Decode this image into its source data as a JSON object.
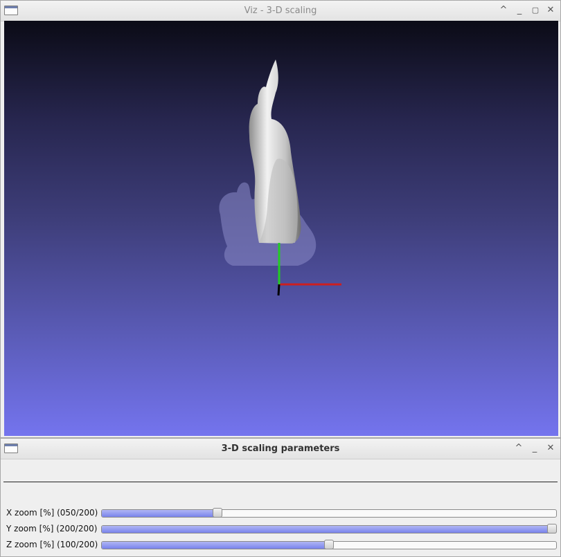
{
  "viz_window": {
    "title": "Viz - 3-D scaling",
    "icon": "window-menu-icon",
    "controls": [
      "shade-icon",
      "minimize-icon",
      "maximize-icon",
      "close-icon"
    ],
    "colors": {
      "axis_x": "#cc1f1f",
      "axis_y": "#22cc22",
      "axis_z": "#000000",
      "bg_top": "#0b0b16",
      "bg_bottom": "#7474ee"
    }
  },
  "param_window": {
    "title": "3-D scaling parameters",
    "icon": "window-menu-icon",
    "controls": [
      "shade-icon",
      "minimize-icon",
      "close-icon"
    ],
    "trackbars": [
      {
        "label": "X zoom [%] (050/200)",
        "value": 50,
        "max": 200
      },
      {
        "label": "Y zoom [%] (200/200)",
        "value": 200,
        "max": 200
      },
      {
        "label": "Z zoom [%] (100/200)",
        "value": 100,
        "max": 200
      }
    ],
    "colors": {
      "fill": "#7983ec"
    }
  }
}
